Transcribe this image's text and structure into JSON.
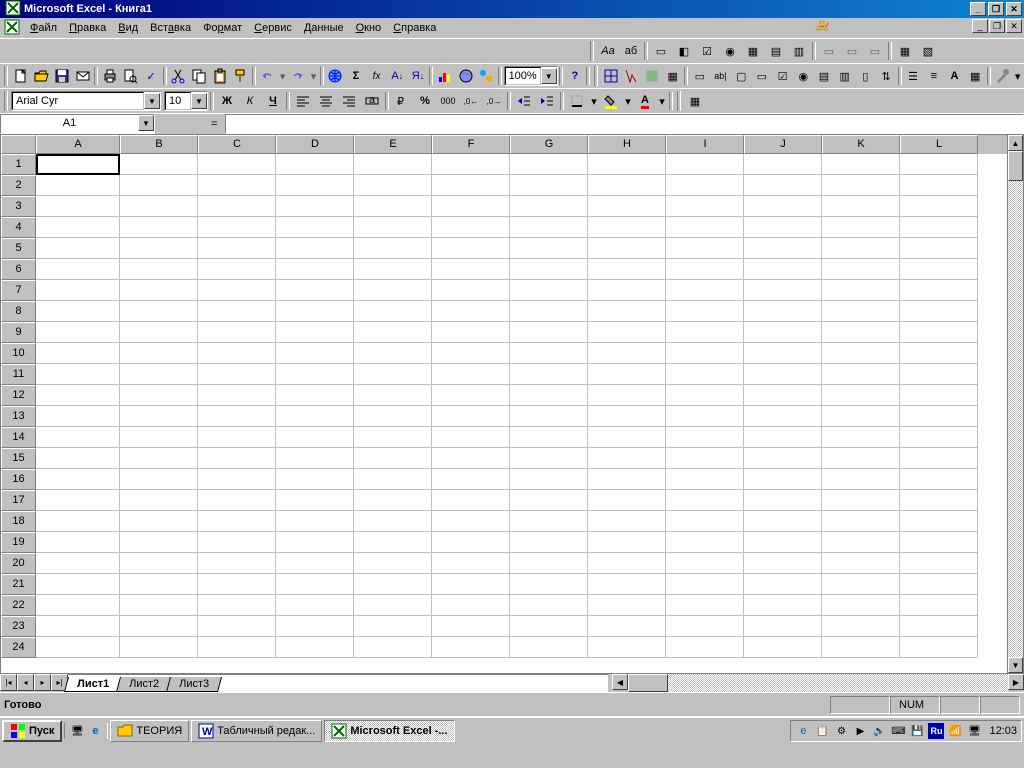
{
  "title": "Microsoft Excel - Книга1",
  "menus": [
    "Файл",
    "Правка",
    "Вид",
    "Вставка",
    "Формат",
    "Сервис",
    "Данные",
    "Окно",
    "Справка"
  ],
  "menu_underline_idx": [
    0,
    0,
    0,
    3,
    2,
    0,
    0,
    0,
    0
  ],
  "font": {
    "name": "Arial Cyr",
    "size": "10"
  },
  "zoom": "100%",
  "namebox": "A1",
  "formula_prefix": "=",
  "columns": [
    "A",
    "B",
    "C",
    "D",
    "E",
    "F",
    "G",
    "H",
    "I",
    "J",
    "K",
    "L"
  ],
  "rows": [
    1,
    2,
    3,
    4,
    5,
    6,
    7,
    8,
    9,
    10,
    11,
    12,
    13,
    14,
    15,
    16,
    17,
    18,
    19,
    20,
    21,
    22,
    23,
    24
  ],
  "sheets": [
    "Лист1",
    "Лист2",
    "Лист3"
  ],
  "active_sheet": 0,
  "status": "Готово",
  "indicators": {
    "num": "NUM"
  },
  "taskbar": {
    "start": "Пуск",
    "tasks": [
      {
        "label": "ТЕОРИЯ",
        "icon": "folder",
        "active": false
      },
      {
        "label": "Табличный редак...",
        "icon": "word",
        "active": false
      },
      {
        "label": "Microsoft Excel -...",
        "icon": "excel",
        "active": true
      }
    ],
    "clock": "12:03"
  },
  "format_buttons": {
    "bold": "Ж",
    "italic": "К",
    "underline": "Ч",
    "currency": "%"
  },
  "tb_labels": {
    "sigma": "Σ",
    "fx": "fx",
    "sort_asc": "А↓",
    "sort_desc": "Я↓",
    "font_aa": "Aa",
    "font_ab": "аб",
    "font_A": "A"
  }
}
